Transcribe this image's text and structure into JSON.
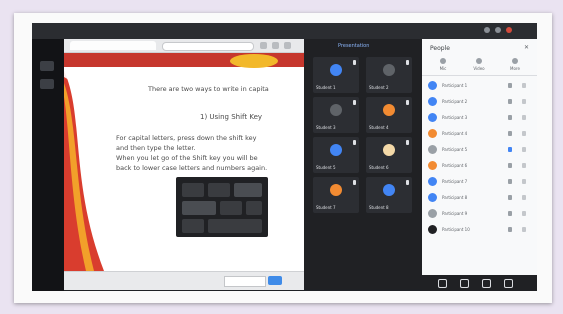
{
  "slide": {
    "lines": [
      "There are two ways to write in capita",
      "1) Using Shift Key",
      "For capital letters, press down the shift key",
      "and then type the letter.",
      "When you let go of the Shift key you will be",
      "back to lower case letters and numbers again."
    ]
  },
  "meet": {
    "present_label": "Presentation",
    "participants": [
      {
        "name": "Student 1",
        "color": "#4285f4"
      },
      {
        "name": "Student 2",
        "color": "#5f6368"
      },
      {
        "name": "Student 3",
        "color": "#5f6368"
      },
      {
        "name": "Student 4",
        "color": "#f28b32"
      },
      {
        "name": "Student 5",
        "color": "#4285f4"
      },
      {
        "name": "Student 6",
        "color": "#f4d9a8"
      },
      {
        "name": "Student 7",
        "color": "#f28b32"
      },
      {
        "name": "Student 8",
        "color": "#4285f4"
      }
    ]
  },
  "people": {
    "title": "People",
    "close": "✕",
    "tabs": [
      "Mic",
      "Video",
      "More"
    ],
    "rows": [
      {
        "name": "Participant 1",
        "color": "#4285f4"
      },
      {
        "name": "Participant 2",
        "color": "#4285f4"
      },
      {
        "name": "Participant 3",
        "color": "#4285f4"
      },
      {
        "name": "Participant 4",
        "color": "#f28b32"
      },
      {
        "name": "Participant 5",
        "color": "#9aa0a6"
      },
      {
        "name": "Participant 6",
        "color": "#f28b32"
      },
      {
        "name": "Participant 7",
        "color": "#4285f4"
      },
      {
        "name": "Participant 8",
        "color": "#4285f4"
      },
      {
        "name": "Participant 9",
        "color": "#9aa0a6"
      },
      {
        "name": "Participant 10",
        "color": "#202124"
      }
    ]
  },
  "icons": [
    "chrome-close-icon",
    "mic-icon",
    "people-icon",
    "keyboard-image"
  ]
}
